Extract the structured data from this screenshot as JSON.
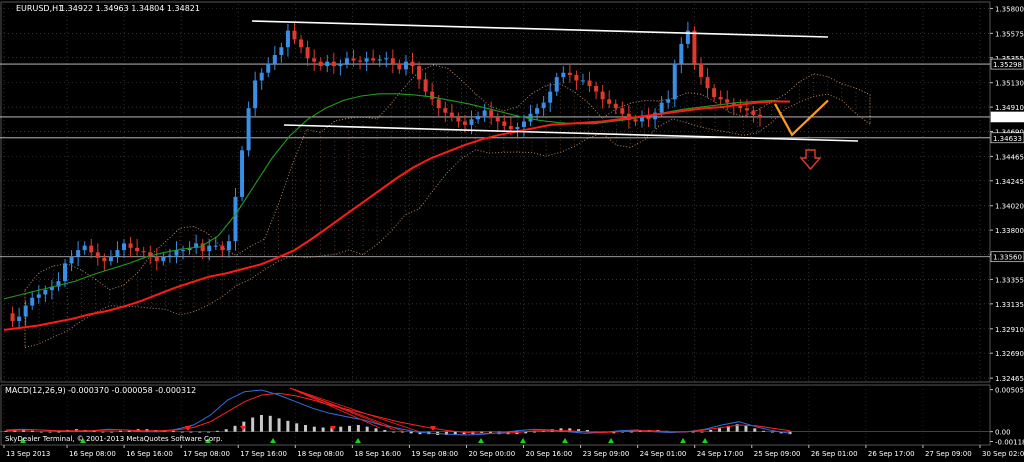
{
  "header": {
    "symbol_label": "EURUSD,H1",
    "ohlc": "1.34922 1.34963 1.34804 1.34821"
  },
  "macd_header": {
    "label": "MACD(12,26,9)",
    "values": "-0.000370 -0.000058 -0.000312"
  },
  "watermark": "SkyDealer Terminal, © 2001-2013 MetaQuotes Software Corp.",
  "colors": {
    "background": "#000000",
    "candle_up": "#3a8ee6",
    "candle_down": "#e03a2f",
    "ma_red": "#ff1a1a",
    "ma_green": "#1f9c1f",
    "cloud_dots": "#f0b08a",
    "trendline": "#ffffff",
    "projection": "#ff9a1f",
    "arrow_down": "#e03a2f",
    "macd_hist": "#c8c8c8",
    "macd_blue": "#2e6fe0",
    "macd_red": "#ff2020",
    "current_price_box": "#ffffff"
  },
  "chart_data": {
    "type": "candlestick",
    "price_axis": {
      "ticks": [
        "1.35800",
        "1.35575",
        "1.35355",
        "1.35130",
        "1.34910",
        "1.34690",
        "1.34465",
        "1.34245",
        "1.34020",
        "1.33800",
        "1.33580",
        "1.33355",
        "1.33135",
        "1.32910",
        "1.32690",
        "1.32465"
      ],
      "tick_values": [
        1.358,
        1.35575,
        1.35355,
        1.3513,
        1.3491,
        1.3469,
        1.34465,
        1.34245,
        1.3402,
        1.338,
        1.3358,
        1.33355,
        1.33135,
        1.3291,
        1.3269,
        1.32465
      ],
      "boxed_levels": [
        {
          "label": "1.35298",
          "value": 1.35298
        },
        {
          "label": "1.34821",
          "value": 1.34821
        },
        {
          "label": "1.34633",
          "value": 1.34633
        },
        {
          "label": "1.33560",
          "value": 1.3356
        }
      ],
      "current_price": "1.34821",
      "ylim": [
        1.3243,
        1.3584
      ]
    },
    "time_axis": {
      "ticks": [
        "13 Sep 2013",
        "16 Sep 08:00",
        "16 Sep 16:00",
        "17 Sep 08:00",
        "17 Sep 16:00",
        "18 Sep 08:00",
        "18 Sep 16:00",
        "19 Sep 08:00",
        "20 Sep 00:00",
        "20 Sep 16:00",
        "23 Sep 09:00",
        "24 Sep 01:00",
        "24 Sep 17:00",
        "25 Sep 09:00",
        "26 Sep 01:00",
        "26 Sep 17:00",
        "27 Sep 09:00",
        "30 Sep 02:00"
      ]
    },
    "macd_axis": {
      "ticks": [
        "0.00505",
        "0.00",
        "-0.00118"
      ],
      "tick_values": [
        0.00505,
        0.0,
        -0.00118
      ],
      "ylim": [
        -0.0016,
        0.0056
      ]
    },
    "series": [
      {
        "name": "price_path",
        "values": [
          1.3305,
          1.3298,
          1.3302,
          1.3312,
          1.3319,
          1.3322,
          1.3326,
          1.3329,
          1.3334,
          1.335,
          1.3356,
          1.3362,
          1.3366,
          1.336,
          1.3355,
          1.3352,
          1.3356,
          1.3362,
          1.3368,
          1.3364,
          1.3361,
          1.336,
          1.3356,
          1.3352,
          1.3356,
          1.3357,
          1.3362,
          1.3362,
          1.3364,
          1.3368,
          1.3361,
          1.3366,
          1.3366,
          1.3362,
          1.337,
          1.341,
          1.3452,
          1.349,
          1.3515,
          1.3522,
          1.353,
          1.3538,
          1.3545,
          1.356,
          1.3552,
          1.3545,
          1.3535,
          1.3532,
          1.3528,
          1.3532,
          1.3528,
          1.353,
          1.3535,
          1.3533,
          1.3532,
          1.3535,
          1.3533,
          1.3534,
          1.3535,
          1.353,
          1.3525,
          1.3532,
          1.3528,
          1.3516,
          1.3505,
          1.3498,
          1.349,
          1.3486,
          1.3482,
          1.3478,
          1.3475,
          1.348,
          1.3483,
          1.3488,
          1.3482,
          1.3478,
          1.3474,
          1.3471,
          1.3473,
          1.3478,
          1.3485,
          1.349,
          1.3495,
          1.3505,
          1.3518,
          1.3522,
          1.352,
          1.3515,
          1.3515,
          1.351,
          1.3505,
          1.3498,
          1.3494,
          1.349,
          1.3485,
          1.348,
          1.3478,
          1.3482,
          1.348,
          1.3486,
          1.3495,
          1.3498,
          1.353,
          1.3548,
          1.356,
          1.353,
          1.3518,
          1.3508,
          1.35,
          1.3498,
          1.3495,
          1.3492,
          1.349,
          1.3488,
          1.3484,
          1.3482
        ]
      },
      {
        "name": "ma_red",
        "values": [
          1.329,
          1.3292,
          1.3294,
          1.3297,
          1.33,
          1.3304,
          1.3307,
          1.3311,
          1.3316,
          1.3322,
          1.3328,
          1.3333,
          1.3338,
          1.3341,
          1.3345,
          1.3349,
          1.3355,
          1.3362,
          1.3372,
          1.3383,
          1.3394,
          1.3405,
          1.3416,
          1.3427,
          1.3437,
          1.3445,
          1.3451,
          1.3457,
          1.3462,
          1.3466,
          1.3469,
          1.3472,
          1.3475,
          1.3476,
          1.3477,
          1.3478,
          1.348,
          1.3482,
          1.3484,
          1.3486,
          1.3488,
          1.349,
          1.3491,
          1.3493,
          1.3495,
          1.3496,
          1.3496
        ]
      },
      {
        "name": "ma_green",
        "values": [
          1.3318,
          1.3322,
          1.3326,
          1.333,
          1.3334,
          1.334,
          1.3345,
          1.335,
          1.3356,
          1.336,
          1.3363,
          1.3365,
          1.3375,
          1.3395,
          1.342,
          1.3445,
          1.3465,
          1.348,
          1.349,
          1.3497,
          1.3501,
          1.3503,
          1.3503,
          1.3502,
          1.35,
          1.3497,
          1.3494,
          1.349,
          1.3486,
          1.3482,
          1.3479,
          1.3477,
          1.3476,
          1.3476,
          1.3478,
          1.348,
          1.3483,
          1.3486,
          1.3489,
          1.3491,
          1.3493,
          1.3495,
          1.3496,
          1.3497,
          1.3496
        ]
      },
      {
        "name": "projection",
        "values": [
          1.3494,
          1.3466,
          1.3497
        ]
      }
    ],
    "macd_hist": [
      0.0001,
      0.0002,
      0.0003,
      0.0001,
      0.0,
      -0.0001,
      0.0,
      0.0002,
      0.0003,
      0.0002,
      0.0001,
      0.0,
      -0.0001,
      0.0001,
      0.0002,
      0.0003,
      0.0003,
      0.0002,
      0.0002,
      0.0001,
      0.0,
      -0.0001,
      -0.0001,
      -0.0,
      0.0001,
      0.0003,
      0.0007,
      0.0012,
      0.0017,
      0.002,
      0.0019,
      0.0016,
      0.0013,
      0.001,
      0.0008,
      0.0006,
      0.0005,
      0.0005,
      0.0006,
      0.0007,
      0.0008,
      0.0006,
      0.0004,
      0.0002,
      0.0,
      -0.0001,
      -0.0002,
      -0.0003,
      -0.0003,
      -0.0004,
      -0.0004,
      -0.0004,
      -0.0003,
      -0.0003,
      -0.0002,
      -0.0002,
      -0.0003,
      -0.0003,
      -0.0003,
      -0.0002,
      -0.0001,
      0.0001,
      0.0003,
      0.0004,
      0.0004,
      0.0003,
      0.0002,
      0.0,
      -0.0001,
      -0.0002,
      -0.0001,
      0.0,
      0.0001,
      0.0002,
      0.0002,
      0.0001,
      0.0,
      -0.0001,
      -0.0001,
      0.0,
      0.0002,
      0.0004,
      0.0007,
      0.0009,
      0.0007,
      0.0004,
      0.0001,
      -0.0001,
      -0.0002,
      -0.0003
    ],
    "macd_blue": [
      0.0002,
      0.0003,
      0.0002,
      0.0001,
      0.0,
      0.0001,
      0.0003,
      0.0002,
      0.0,
      0.0,
      0.0003,
      0.0008,
      0.002,
      0.0038,
      0.0048,
      0.005,
      0.0044,
      0.0036,
      0.0028,
      0.0022,
      0.0018,
      0.0014,
      0.0008,
      0.0004,
      0.0,
      -0.0002,
      -0.0003,
      -0.0004,
      -0.0003,
      -0.0001,
      0.0001,
      0.0003,
      0.0002,
      0.0,
      -0.0002,
      -0.0001,
      0.0001,
      0.0002,
      0.0,
      -0.0001,
      0.0,
      0.0003,
      0.0008,
      0.0012,
      0.0006,
      0.0001,
      -0.0002
    ],
    "macd_red": [
      0.0001,
      0.0002,
      0.0002,
      0.0001,
      0.0001,
      0.0001,
      0.0002,
      0.0002,
      0.0001,
      0.0001,
      0.0002,
      0.0005,
      0.0012,
      0.0024,
      0.0036,
      0.0044,
      0.0046,
      0.0043,
      0.0038,
      0.0032,
      0.0027,
      0.0022,
      0.0017,
      0.0012,
      0.0008,
      0.0004,
      0.0001,
      -0.0001,
      -0.0002,
      -0.0002,
      -0.0001,
      0.0001,
      0.0001,
      0.0001,
      0.0,
      -0.0001,
      0.0,
      0.0001,
      0.0001,
      0.0,
      0.0,
      0.0002,
      0.0005,
      0.0008,
      0.0007,
      0.0004,
      0.0001
    ]
  }
}
